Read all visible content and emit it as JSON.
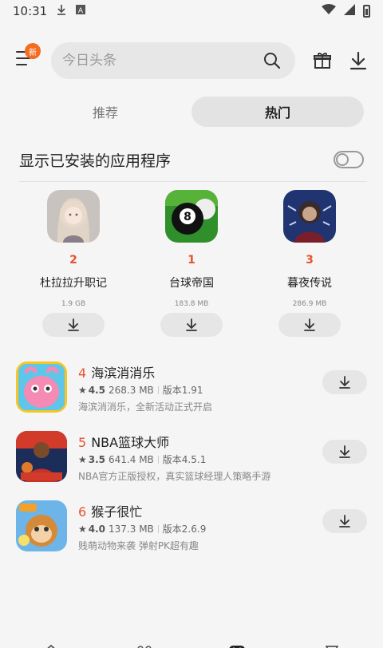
{
  "status_bar": {
    "time": "10:31"
  },
  "header": {
    "new_badge": "新",
    "search_placeholder": "今日头条"
  },
  "tabs": [
    {
      "label": "推荐",
      "active": false
    },
    {
      "label": "热门",
      "active": true
    }
  ],
  "toggle": {
    "label": "显示已安装的应用程序",
    "on": false
  },
  "top_apps": [
    {
      "rank": "2",
      "name": "杜拉拉升职记",
      "size": "1.9 GB",
      "icon": "anime-girl-icon"
    },
    {
      "rank": "1",
      "name": "台球帝国",
      "size": "183.8 MB",
      "icon": "billiard-ball-icon"
    },
    {
      "rank": "3",
      "name": "暮夜传说",
      "size": "286.9 MB",
      "icon": "dark-character-icon"
    }
  ],
  "list_apps": [
    {
      "rank": "4",
      "name": "海滨消消乐",
      "rating": "4.5",
      "size": "268.3 MB",
      "version": "版本1.91",
      "desc": "海滨消消乐，全新活动正式开启"
    },
    {
      "rank": "5",
      "name": "NBA篮球大师",
      "rating": "3.5",
      "size": "641.4 MB",
      "version": "版本4.5.1",
      "desc": "NBA官方正版授权，真实篮球经理人策略手游"
    },
    {
      "rank": "6",
      "name": "猴子很忙",
      "rating": "4.0",
      "size": "137.3 MB",
      "version": "版本2.6.9",
      "desc": "贱萌动物来袭 弹射PK超有趣"
    }
  ],
  "colors": {
    "accent": "#e8512a",
    "badge": "#f36c21",
    "background": "#f5f5f5"
  }
}
